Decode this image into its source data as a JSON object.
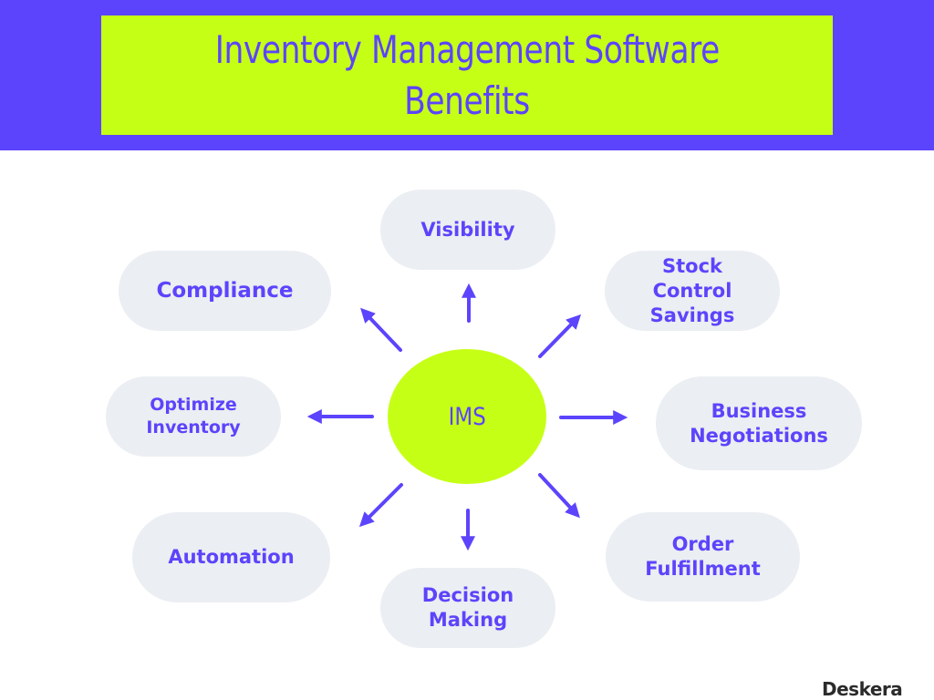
{
  "header": {
    "title_line1": "Inventory Management Software",
    "title_line2": "Benefits"
  },
  "center": {
    "label": "IMS"
  },
  "nodes": {
    "visibility": [
      "Visibility"
    ],
    "compliance": [
      "Compliance"
    ],
    "stock_control_savings": [
      "Stock",
      "Control",
      "Savings"
    ],
    "optimize_inventory": [
      "Optimize",
      "Inventory"
    ],
    "business_negotiations": [
      "Business",
      "Negotiations"
    ],
    "automation": [
      "Automation"
    ],
    "decision_making": [
      "Decision",
      "Making"
    ],
    "order_fulfillment": [
      "Order",
      "Fulfillment"
    ]
  },
  "colors": {
    "primary": "#5c44fc",
    "accent": "#c6ff16",
    "node_bg": "#ebeef2",
    "brand_text": "#2b2b2b"
  },
  "brand": {
    "name": "Deskera"
  }
}
